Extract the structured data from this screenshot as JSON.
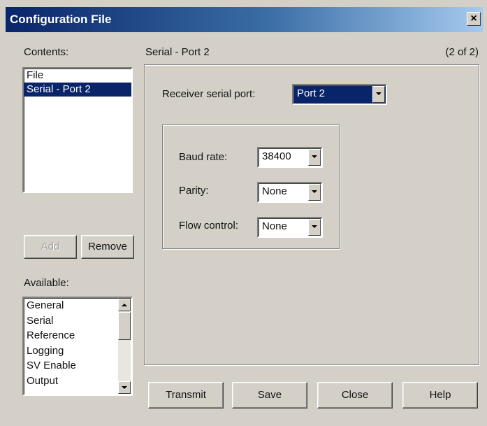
{
  "window": {
    "title": "Configuration File",
    "close_glyph": "×"
  },
  "contents": {
    "label": "Contents:",
    "items": [
      "File",
      "Serial - Port 2"
    ],
    "selected_index": 1
  },
  "header": {
    "section_title": "Serial - Port 2",
    "page_indicator": "(2 of 2)"
  },
  "receiver": {
    "label": "Receiver serial port:",
    "value": "Port 2"
  },
  "settings": {
    "baud_label": "Baud rate:",
    "baud_value": "38400",
    "parity_label": "Parity:",
    "parity_value": "None",
    "flow_label": "Flow control:",
    "flow_value": "None"
  },
  "list_buttons": {
    "add": "Add",
    "remove": "Remove"
  },
  "available": {
    "label": "Available:",
    "items": [
      "General",
      "Serial",
      "Reference",
      "Logging",
      "SV Enable",
      "Output"
    ]
  },
  "footer": {
    "transmit": "Transmit",
    "save": "Save",
    "close": "Close",
    "help": "Help"
  },
  "colors": {
    "face": "#d4d0c8",
    "selection": "#0a246a",
    "title_start": "#0a246a",
    "title_end": "#a6caf0"
  },
  "icons": {
    "close": "close-icon",
    "dropdown": "chevron-down-icon",
    "scroll_up": "arrow-up-icon",
    "scroll_down": "arrow-down-icon"
  }
}
